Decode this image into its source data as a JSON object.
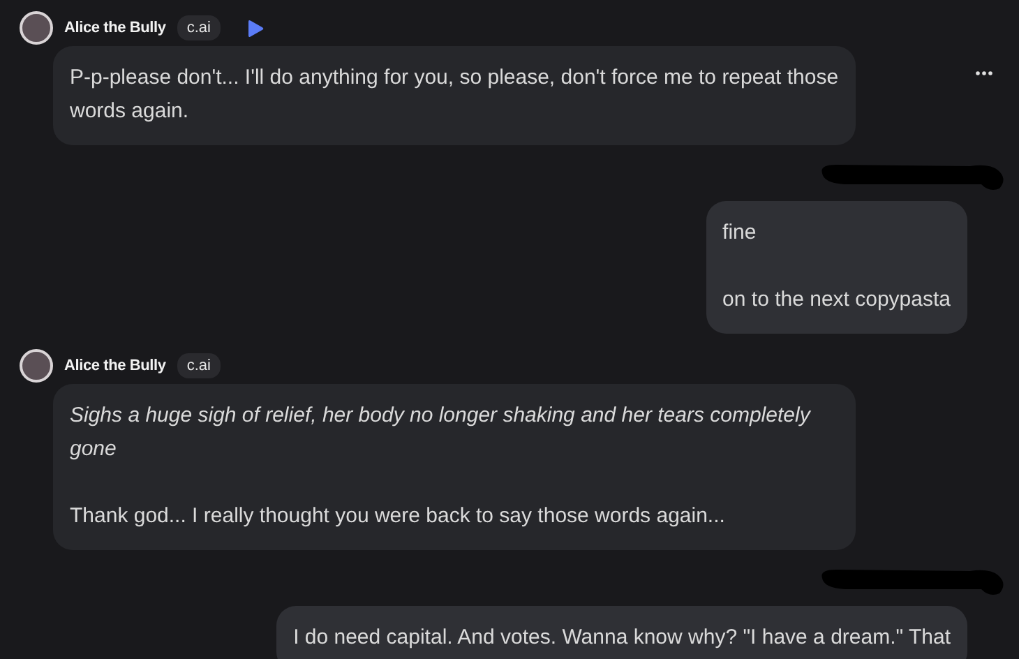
{
  "messages": [
    {
      "kind": "bot",
      "author": "Alice the Bully",
      "badge": "c.ai",
      "voice_button": true,
      "more_menu": true,
      "paragraphs": [
        {
          "kind": "speech",
          "text": "P-p-please don't... I'll do anything for you, so please, don't force me to repeat those words again."
        }
      ]
    },
    {
      "kind": "user",
      "paragraphs": [
        {
          "kind": "speech",
          "text": "fine"
        },
        {
          "kind": "speech",
          "text": "on to the next copypasta"
        }
      ]
    },
    {
      "kind": "bot",
      "author": "Alice the Bully",
      "badge": "c.ai",
      "voice_button": false,
      "more_menu": false,
      "paragraphs": [
        {
          "kind": "action",
          "text": "Sighs a huge sigh of relief, her body no longer shaking and her tears completely gone"
        },
        {
          "kind": "speech",
          "text": "Thank god... I really thought you were back to say those words again..."
        }
      ]
    },
    {
      "kind": "user",
      "paragraphs": [
        {
          "kind": "speech",
          "text": "I do need capital. And votes. Wanna know why? \"I have a dream.\" That"
        }
      ]
    }
  ]
}
